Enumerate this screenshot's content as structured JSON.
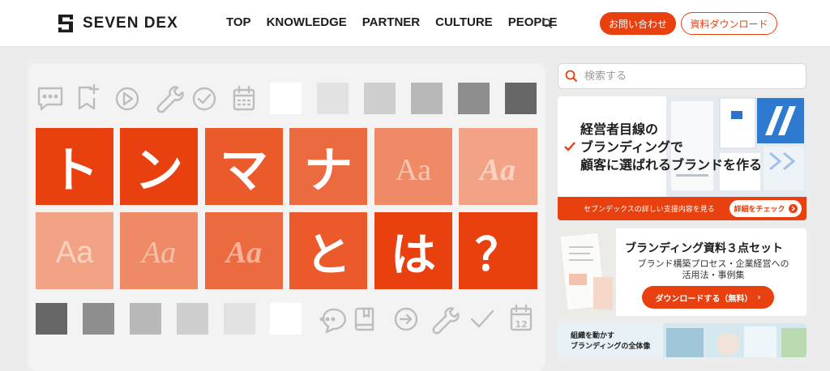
{
  "header": {
    "logo_text": "SEVEN DEX",
    "nav": [
      "TOP",
      "KNOWLEDGE",
      "PARTNER",
      "CULTURE",
      "PEOPLE"
    ],
    "contact_label": "お問い合わせ",
    "docs_label": "資料ダウンロード"
  },
  "hero": {
    "tiles_row1": [
      "ト",
      "ン",
      "マ",
      "ナ",
      "Aa",
      "Aa"
    ],
    "tiles_row2": [
      "Aa",
      "Aa",
      "Aa",
      "と",
      "は",
      "？"
    ],
    "top_icons": [
      "comment-icon",
      "bookmark-add-icon",
      "play-icon",
      "wrench-icon",
      "check-circle-icon",
      "calendar-icon"
    ],
    "bottom_icons": [
      "comment-dots-icon",
      "book-icon",
      "arrow-right-circle-icon",
      "wrench-icon",
      "checkmark-icon",
      "calendar-12-icon"
    ],
    "calendar_day": "12"
  },
  "sidebar": {
    "search_placeholder": "検索する",
    "banner1": {
      "title_lines": [
        "経営者目線の",
        "ブランディングで",
        "顧客に選ばれるブランドを作る"
      ],
      "bar_text": "セブンデックスの詳しい支援内容を見る",
      "button": "詳細をチェック"
    },
    "banner2": {
      "title": "ブランディング資料３点セット",
      "sub_lines": [
        "ブランド構築プロセス・企業経営への",
        "活用法・事例集"
      ],
      "button": "ダウンロードする（無料）"
    },
    "banner3": {
      "lines": [
        "組織を動かす",
        "ブランディングの全体像"
      ]
    }
  },
  "colors": {
    "accent": "#e8400f",
    "tile_strong": "#e8400f",
    "tile_mid": "#ec6a3f",
    "tile_soft": "#f0a78c"
  }
}
